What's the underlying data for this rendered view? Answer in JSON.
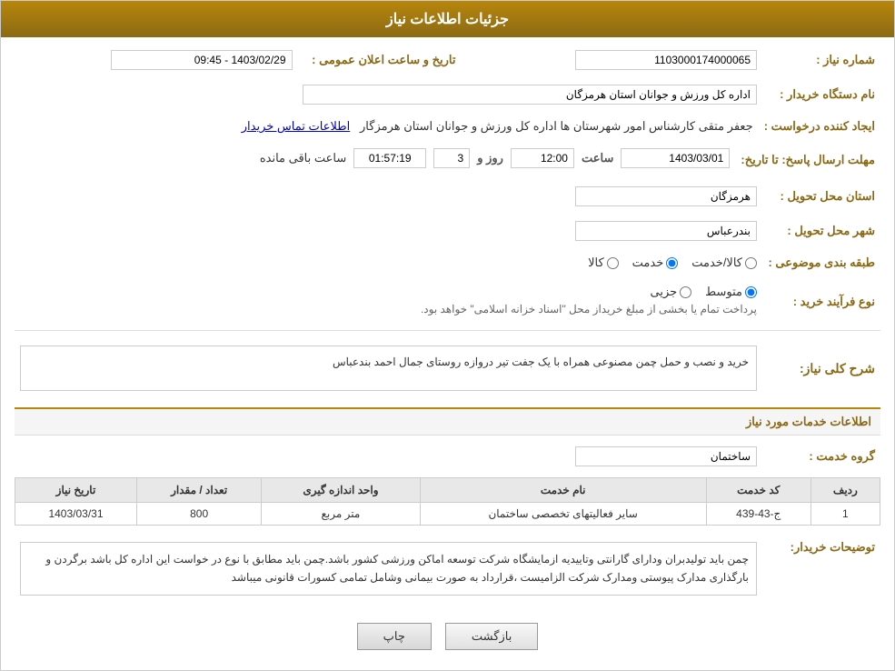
{
  "header": {
    "title": "جزئیات اطلاعات نیاز"
  },
  "fields": {
    "need_number_label": "شماره نیاز :",
    "need_number_value": "1103000174000065",
    "buyer_org_label": "نام دستگاه خریدار :",
    "buyer_org_value": "اداره کل ورزش و جوانان استان هرمزگان",
    "requester_label": "ایجاد کننده درخواست :",
    "requester_value": "جعفر متقی کارشناس امور شهرستان ها اداره کل ورزش و جوانان استان هرمزگار",
    "contact_link": "اطلاعات تماس خریدار",
    "send_date_label": "مهلت ارسال پاسخ: تا تاریخ:",
    "response_date_value": "1403/03/01",
    "response_time_label": "ساعت",
    "response_time_value": "12:00",
    "response_days_label": "روز و",
    "response_days_value": "3",
    "countdown_value": "01:57:19",
    "countdown_label": "ساعت باقی مانده",
    "delivery_province_label": "استان محل تحویل :",
    "delivery_province_value": "هرمزگان",
    "delivery_city_label": "شهر محل تحویل :",
    "delivery_city_value": "بندرعباس",
    "category_label": "طبقه بندی موضوعی :",
    "category_options": [
      "کالا",
      "خدمت",
      "کالا/خدمت"
    ],
    "category_selected": "خدمت",
    "purchase_type_label": "نوع فرآیند خرید :",
    "purchase_options": [
      "جزیی",
      "متوسط"
    ],
    "purchase_note": "پرداخت تمام یا بخشی از مبلغ خریداز محل \"اسناد خزانه اسلامی\" خواهد بود.",
    "announcement_date_label": "تاریخ و ساعت اعلان عمومی :",
    "announcement_date_value": "1403/02/29 - 09:45",
    "need_description_label": "شرح کلی نیاز:",
    "need_description_value": "خرید و نصب و حمل چمن مصنوعی همراه با یک جفت تیر دروازه روستای جمال احمد بندعباس",
    "services_section_label": "اطلاعات خدمات مورد نیاز",
    "service_group_label": "گروه خدمت :",
    "service_group_value": "ساختمان",
    "table": {
      "headers": [
        "ردیف",
        "کد خدمت",
        "نام خدمت",
        "واحد اندازه گیری",
        "تعداد / مقدار",
        "تاریخ نیاز"
      ],
      "rows": [
        {
          "row": "1",
          "service_code": "ج-43-439",
          "service_name": "سایر فعالیتهای تخصصی ساختمان",
          "unit": "متر مربع",
          "quantity": "800",
          "date": "1403/03/31"
        }
      ]
    },
    "buyer_notes_label": "توضیحات خریدار:",
    "buyer_notes_value": "چمن باید تولیدبران ودارای گارانتی وتاییدیه ازمایشگاه شرکت توسعه اماکن ورزشی کشور باشد.چمن باید مطابق با نوع در خواست این اداره کل باشد برگردن و بارگذاری مدارک پیوستی  ومدارک شرکت الزامیست ،قرارداد به صورت بیمانی وشامل تمامی کسورات قانونی میباشد"
  },
  "buttons": {
    "print_label": "چاپ",
    "back_label": "بازگشت"
  }
}
